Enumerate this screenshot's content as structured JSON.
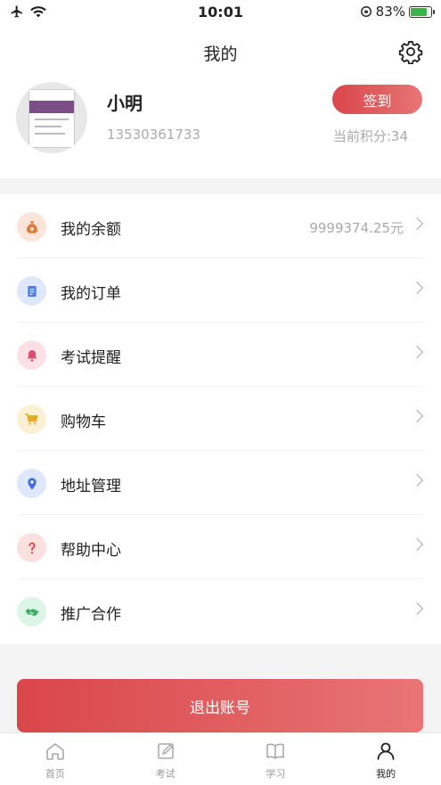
{
  "status_bar": {
    "time": "10:01",
    "battery": "83%",
    "battery_level": 0.83
  },
  "nav": {
    "title": "我的",
    "settings_icon": "gear-icon"
  },
  "profile": {
    "username": "小明",
    "phone": "13530361733",
    "checkin_label": "签到",
    "points": "当前积分:34"
  },
  "menu": {
    "items": [
      {
        "label": "我的余额",
        "value": "9999374.25元",
        "icon": "money-bag-icon",
        "icon_color": "#e07a3a",
        "icon_bg": "#fbe5da"
      },
      {
        "label": "我的订单",
        "value": "",
        "icon": "order-document-icon",
        "icon_color": "#4a7be0",
        "icon_bg": "#dfe7fa"
      },
      {
        "label": "考试提醒",
        "value": "",
        "icon": "bell-icon",
        "icon_color": "#e04a6d",
        "icon_bg": "#fbe0e6"
      },
      {
        "label": "购物车",
        "value": "",
        "icon": "shopping-cart-icon",
        "icon_color": "#e0a92a",
        "icon_bg": "#faf0d3"
      },
      {
        "label": "地址管理",
        "value": "",
        "icon": "location-pin-icon",
        "icon_color": "#3f6ee0",
        "icon_bg": "#dfe7fa"
      },
      {
        "label": "帮助中心",
        "value": "",
        "icon": "question-icon",
        "icon_color": "#e04040",
        "icon_bg": "#fbe0e0"
      },
      {
        "label": "推广合作",
        "value": "",
        "icon": "handshake-icon",
        "icon_color": "#3fb06a",
        "icon_bg": "#ddf5e5"
      }
    ]
  },
  "logout": {
    "label": "退出账号"
  },
  "tabbar": {
    "tabs": [
      {
        "label": "首页",
        "icon": "home-icon"
      },
      {
        "label": "考试",
        "icon": "exam-edit-icon"
      },
      {
        "label": "学习",
        "icon": "book-icon"
      },
      {
        "label": "我的",
        "icon": "user-icon",
        "active": true
      }
    ]
  },
  "colors": {
    "accent": "#d9464a",
    "accent_light": "#e87575",
    "background": "#f4f4f4"
  }
}
